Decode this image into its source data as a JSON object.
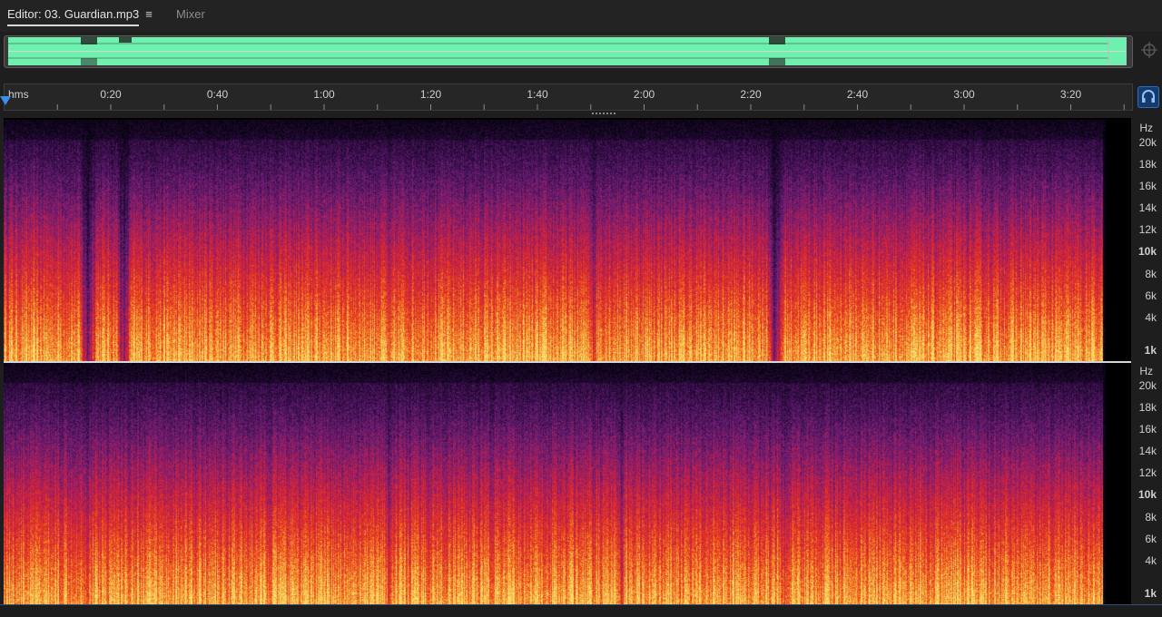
{
  "tabs": {
    "editor_label": "Editor: 03. Guardian.mp3",
    "mixer_label": "Mixer"
  },
  "icons": {
    "menu": "hamburger-menu-icon",
    "zoom": "zoom-navigator-icon",
    "monitor": "headphones-icon",
    "playhead": "playhead-marker-icon"
  },
  "colors": {
    "overview_wave": "#6ef0ae",
    "playhead": "#3b8fe8",
    "spectral_low": "#f7d25a",
    "spectral_mid": "#e83a1c",
    "spectral_high": "#6a1f7a"
  },
  "timeline": {
    "unit_label": "hms",
    "marks": [
      "0:20",
      "0:40",
      "1:00",
      "1:20",
      "1:40",
      "2:00",
      "2:20",
      "2:40",
      "3:00",
      "3:20"
    ]
  },
  "frequency_axis": {
    "unit": "Hz",
    "labels": [
      "20k",
      "18k",
      "16k",
      "14k",
      "12k",
      "10k",
      "8k",
      "6k",
      "4k",
      "1k"
    ]
  }
}
